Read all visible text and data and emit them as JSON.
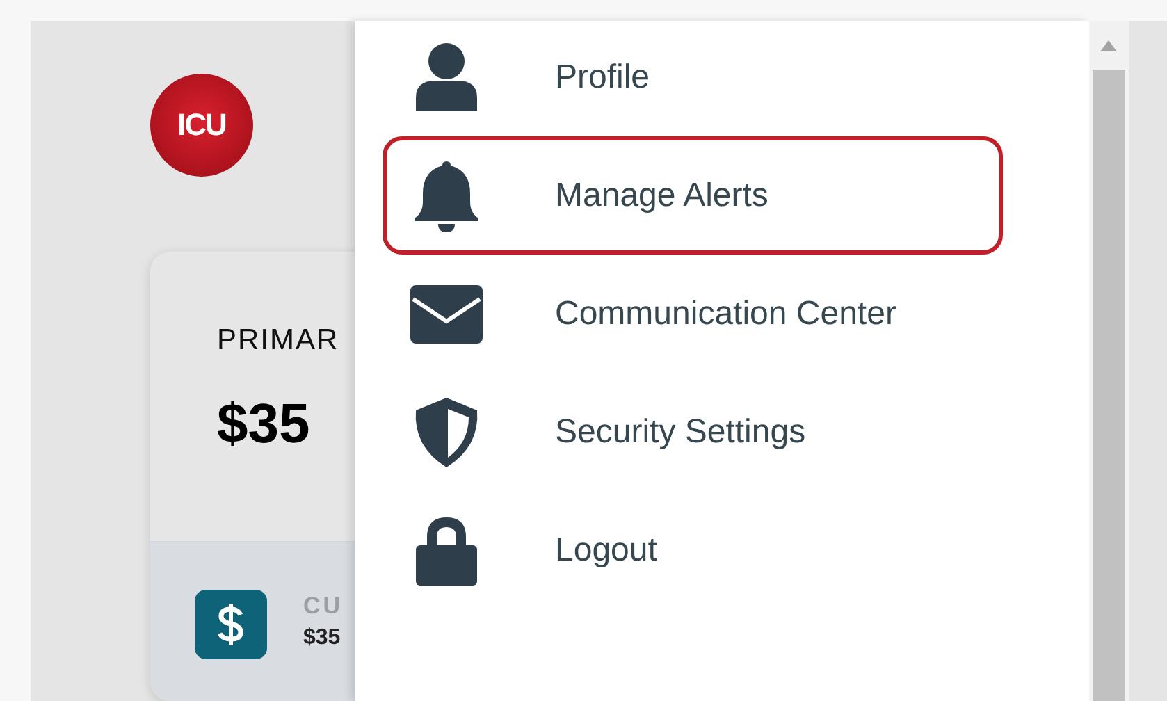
{
  "logo": {
    "text": "ICU"
  },
  "account_card": {
    "title": "PRIMAR",
    "balance": "$35",
    "sub_account": {
      "name": "CU",
      "amount": "$35"
    }
  },
  "menu": {
    "items": [
      {
        "kind": "person",
        "label": "Profile",
        "selected": false
      },
      {
        "kind": "bell",
        "label": "Manage Alerts",
        "selected": true
      },
      {
        "kind": "envelope",
        "label": "Communication Center",
        "selected": false
      },
      {
        "kind": "shield",
        "label": "Security Settings",
        "selected": false
      },
      {
        "kind": "lock",
        "label": "Logout",
        "selected": false
      }
    ]
  }
}
